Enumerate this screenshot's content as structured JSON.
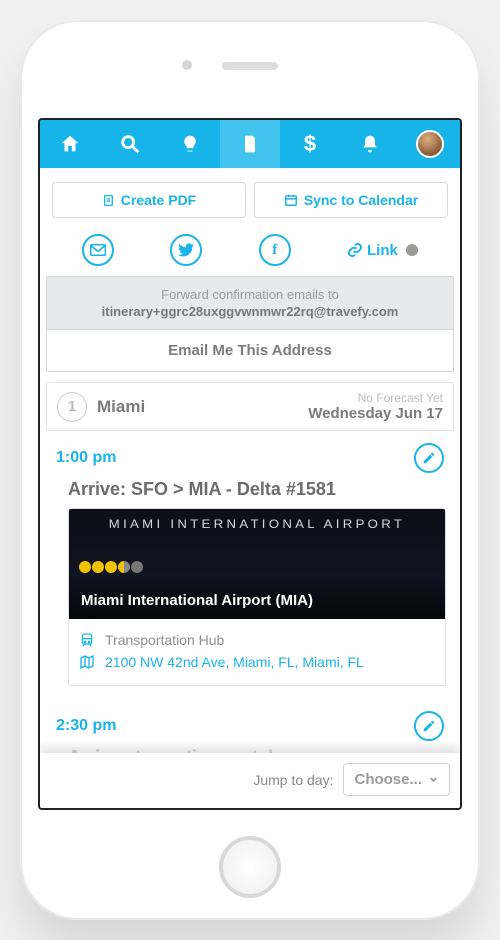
{
  "nav": {
    "icons": [
      "home-icon",
      "search-icon",
      "bulb-icon",
      "doc-icon",
      "dollar-icon",
      "bell-icon",
      "avatar"
    ],
    "active_index": 3
  },
  "actions": {
    "create_pdf": "Create PDF",
    "sync_cal": "Sync to Calendar"
  },
  "share": {
    "link_label": "Link"
  },
  "forward": {
    "intro": "Forward confirmation emails to",
    "email": "itinerary+ggrc28uxggvwnmwr22rq@travefy.com",
    "button": "Email Me This Address"
  },
  "day": {
    "number": "1",
    "city": "Miami",
    "forecast": "No Forecast Yet",
    "date": "Wednesday Jun 17"
  },
  "events": [
    {
      "time": "1:00 pm",
      "title": "Arrive: SFO > MIA - Delta #1581",
      "place": {
        "banner": "MIAMI INTERNATIONAL AIRPORT",
        "name": "Miami International Airport (MIA)",
        "category": "Transportation Hub",
        "address": "2100 NW 42nd Ave, Miami, FL, Miami, FL",
        "rating": 3.5
      }
    },
    {
      "time": "2:30 pm",
      "title": "Arrive at vacation rental"
    }
  ],
  "footer": {
    "jump_label": "Jump to day:",
    "choose_label": "Choose..."
  }
}
